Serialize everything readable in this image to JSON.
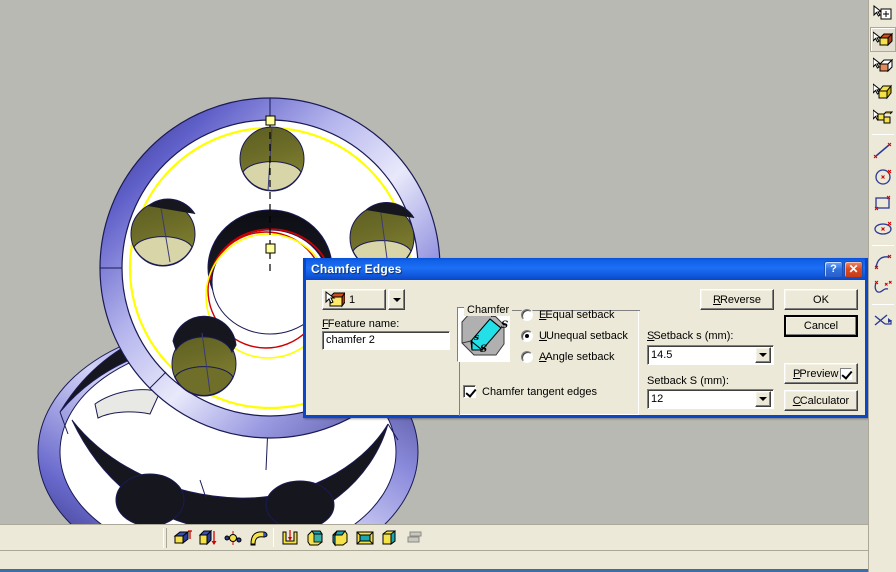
{
  "viewport": {
    "background_color": "#b9b9b3",
    "model": {
      "name": "flywheel-hub-part",
      "body_color": "#ffffff",
      "shaded_edge_color": "#5b5bc8",
      "dark_face_color": "#16161e",
      "hole_face_color": "#6b6b28",
      "hole_bottom_color": "#d8d6a8",
      "highlight_edge_color": "#ffff00",
      "selected_edge_color": "#cc0000",
      "axis_color": "#000000",
      "handle_color": "#ffff66"
    }
  },
  "dialog": {
    "title": "Chamfer Edges",
    "help_button": "?",
    "close_button": "✕",
    "selection_count": "1",
    "selection_icon": "pick-solid-icon",
    "feature_name_label": "Feature name:",
    "feature_name_value": "chamfer 2",
    "group_legend": "Chamfer",
    "chamfer_preview_icon": "chamfer-diagram-icon",
    "radio_options": [
      {
        "label": "Equal setback",
        "accel": "E",
        "selected": false
      },
      {
        "label": "Unequal setback",
        "accel": "U",
        "selected": true
      },
      {
        "label": "Angle setback",
        "accel": "A",
        "selected": false
      }
    ],
    "tangent_checkbox": {
      "label": "Chamfer tangent edges",
      "accel": "t",
      "checked": true
    },
    "setback_s_label": "Setback s (mm):",
    "setback_s_value": "14.5",
    "setback_S_label": "Setback S (mm):",
    "setback_S_value": "12",
    "buttons": {
      "reverse": "Reverse",
      "ok": "OK",
      "cancel": "Cancel",
      "preview": "Preview",
      "calculator": "Calculator"
    },
    "preview_checked": true,
    "colors": {
      "border": "#0a46c8",
      "title_gradient_start": "#1c6ff5",
      "face": "#ece9d8"
    }
  },
  "right_toolbar": {
    "items": [
      {
        "name": "select-datum-icon",
        "active": false
      },
      {
        "name": "select-solid-body-icon",
        "active": true
      },
      {
        "name": "select-face-icon",
        "active": false
      },
      {
        "name": "select-feature-icon",
        "active": false
      },
      {
        "name": "select-component-icon",
        "active": false
      },
      {
        "name": "separator",
        "active": false
      },
      {
        "name": "select-line-icon",
        "active": false
      },
      {
        "name": "select-circle-icon",
        "active": false
      },
      {
        "name": "select-rectangle-icon",
        "active": false
      },
      {
        "name": "select-ellipse-icon",
        "active": false
      },
      {
        "name": "separator",
        "active": false
      },
      {
        "name": "select-arc-icon",
        "active": false
      },
      {
        "name": "select-spline-icon",
        "active": false
      },
      {
        "name": "separator",
        "active": false
      },
      {
        "name": "select-trim-icon",
        "active": false
      }
    ]
  },
  "bottom_toolbar": {
    "items": [
      {
        "name": "extrude-icon"
      },
      {
        "name": "revolve-icon"
      },
      {
        "name": "sweep-icon"
      },
      {
        "name": "loft-icon"
      },
      {
        "name": "separator"
      },
      {
        "name": "shell-icon"
      },
      {
        "name": "chamfer-icon"
      },
      {
        "name": "fillet-icon"
      },
      {
        "name": "hollow-box-icon"
      },
      {
        "name": "draft-icon"
      },
      {
        "name": "pattern-icon"
      }
    ]
  },
  "status_bar": {
    "text": ""
  }
}
